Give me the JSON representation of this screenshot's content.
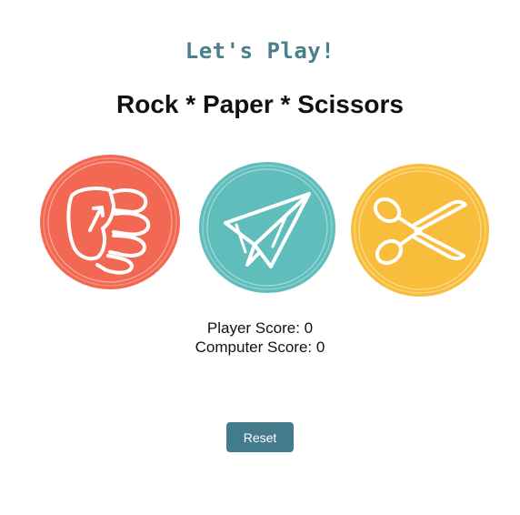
{
  "header": {
    "subtitle": "Let's Play!",
    "title": "Rock * Paper * Scissors"
  },
  "choices": [
    {
      "name": "rock",
      "icon": "fist-icon",
      "color": "#f26852"
    },
    {
      "name": "paper",
      "icon": "paper-plane-icon",
      "color": "#5fbdbb"
    },
    {
      "name": "scissors",
      "icon": "scissors-icon",
      "color": "#f8bd3b"
    }
  ],
  "scores": {
    "player_label": "Player Score: ",
    "player_value": "0",
    "computer_label": "Computer Score: ",
    "computer_value": "0"
  },
  "controls": {
    "reset_label": "Reset",
    "reset_color": "#437a8c"
  }
}
